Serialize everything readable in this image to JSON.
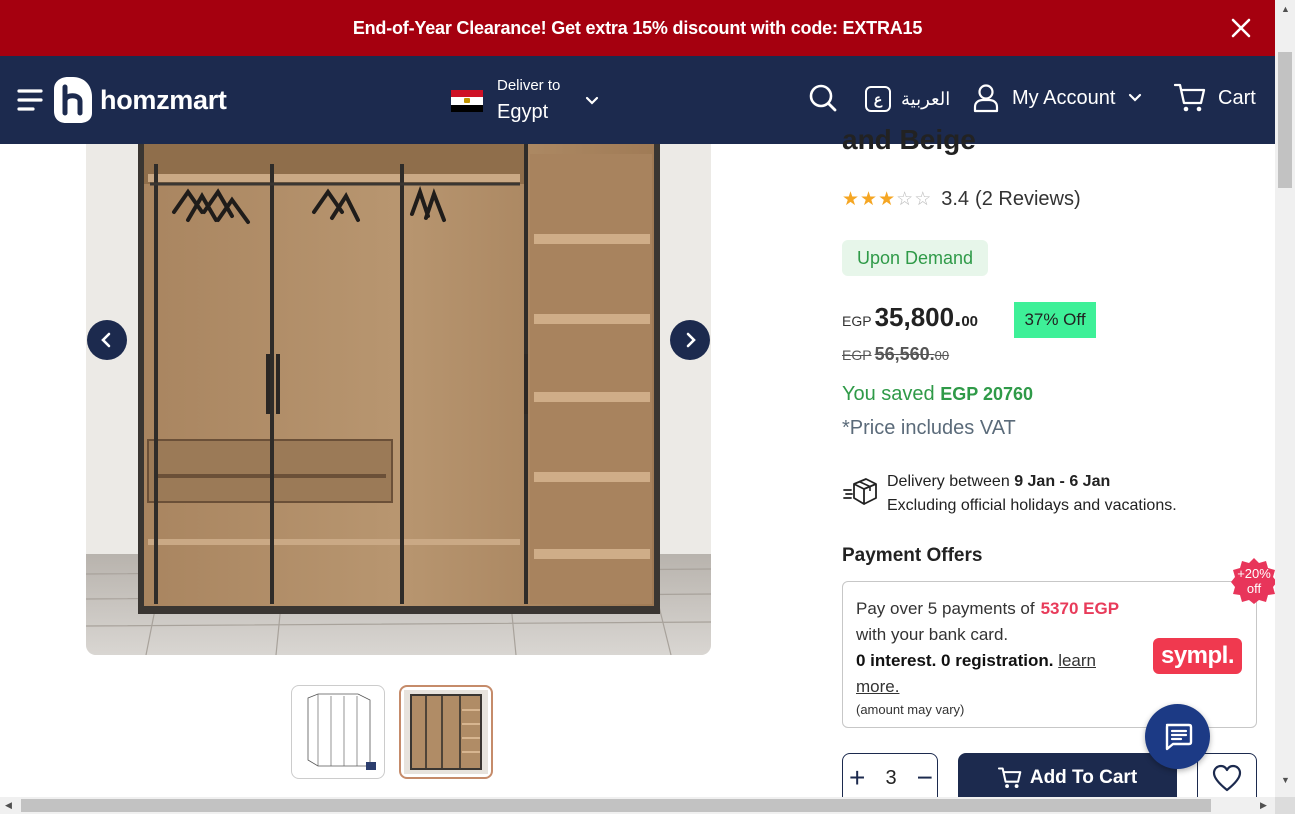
{
  "promo": {
    "text": "End-of-Year Clearance! Get extra 15% discount with code: EXTRA15"
  },
  "header": {
    "logo": "homzmart",
    "deliver_label": "Deliver to",
    "deliver_country": "Egypt",
    "language": "العربية",
    "language_badge": "ع",
    "account": "My Account",
    "cart": "Cart"
  },
  "product": {
    "title_fragment": "and Beige",
    "rating": "3.4",
    "reviews": "(2 Reviews)",
    "stars_filled": 3,
    "stars_total": 5,
    "availability": "Upon Demand",
    "price": {
      "currency": "EGP",
      "main": "35,800.",
      "decimals": "00"
    },
    "discount": "37% Off",
    "old_price": {
      "currency": "EGP",
      "main": "56,560.",
      "decimals": "00"
    },
    "saved_label": "You saved",
    "saved_amount": "EGP 20760",
    "vat_note": "*Price includes VAT"
  },
  "delivery": {
    "prefix": "Delivery between",
    "dates": "9 Jan - 6 Jan",
    "note": "Excluding official holidays and vacations."
  },
  "payment": {
    "title": "Payment Offers",
    "line1_prefix": "Pay over 5 payments of",
    "line1_amount": "5370 EGP",
    "line2": "with your bank card.",
    "line3_bold": "0 interest. 0 registration.",
    "learn_more": "learn more.",
    "small": "(amount may vary)",
    "provider": "sympl.",
    "badge_line1": "+20%",
    "badge_line2": "off"
  },
  "actions": {
    "quantity": "3",
    "plus": "+",
    "minus": "−",
    "add_to_cart": "Add To Cart"
  },
  "colors": {
    "promo_bg": "#a5000f",
    "header_bg": "#1c2a4e",
    "green": "#2f9a48",
    "discount_bg": "#3ef098",
    "sympl": "#f0394f",
    "star": "#f5a623"
  }
}
